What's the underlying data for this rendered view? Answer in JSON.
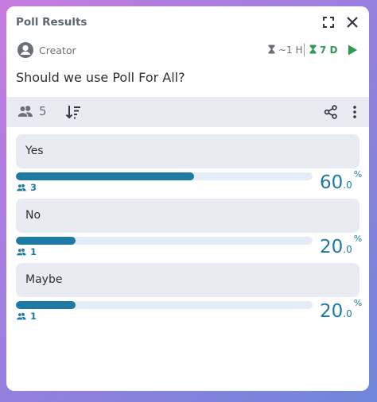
{
  "header": {
    "title": "Poll Results"
  },
  "meta": {
    "creator": "Creator",
    "time_left": "~1 H",
    "duration": "7 D"
  },
  "question": "Should we use Poll For All?",
  "toolbar": {
    "vote_count": "5"
  },
  "options": [
    {
      "label": "Yes",
      "votes": "3",
      "percent_int": "60",
      "percent_dec": ".0",
      "percent_sign": "%",
      "fraction": 0.6
    },
    {
      "label": "No",
      "votes": "1",
      "percent_int": "20",
      "percent_dec": ".0",
      "percent_sign": "%",
      "fraction": 0.2
    },
    {
      "label": "Maybe",
      "votes": "1",
      "percent_int": "20",
      "percent_dec": ".0",
      "percent_sign": "%",
      "fraction": 0.2
    }
  ],
  "colors": {
    "accent": "#1e79a3",
    "active": "#2e9a57",
    "panel": "#e8ebf2"
  },
  "icons": [
    "expand-icon",
    "close-icon",
    "user-avatar-icon",
    "hourglass-icon",
    "play-icon",
    "group-icon",
    "sort-icon",
    "share-icon",
    "more-vertical-icon"
  ]
}
